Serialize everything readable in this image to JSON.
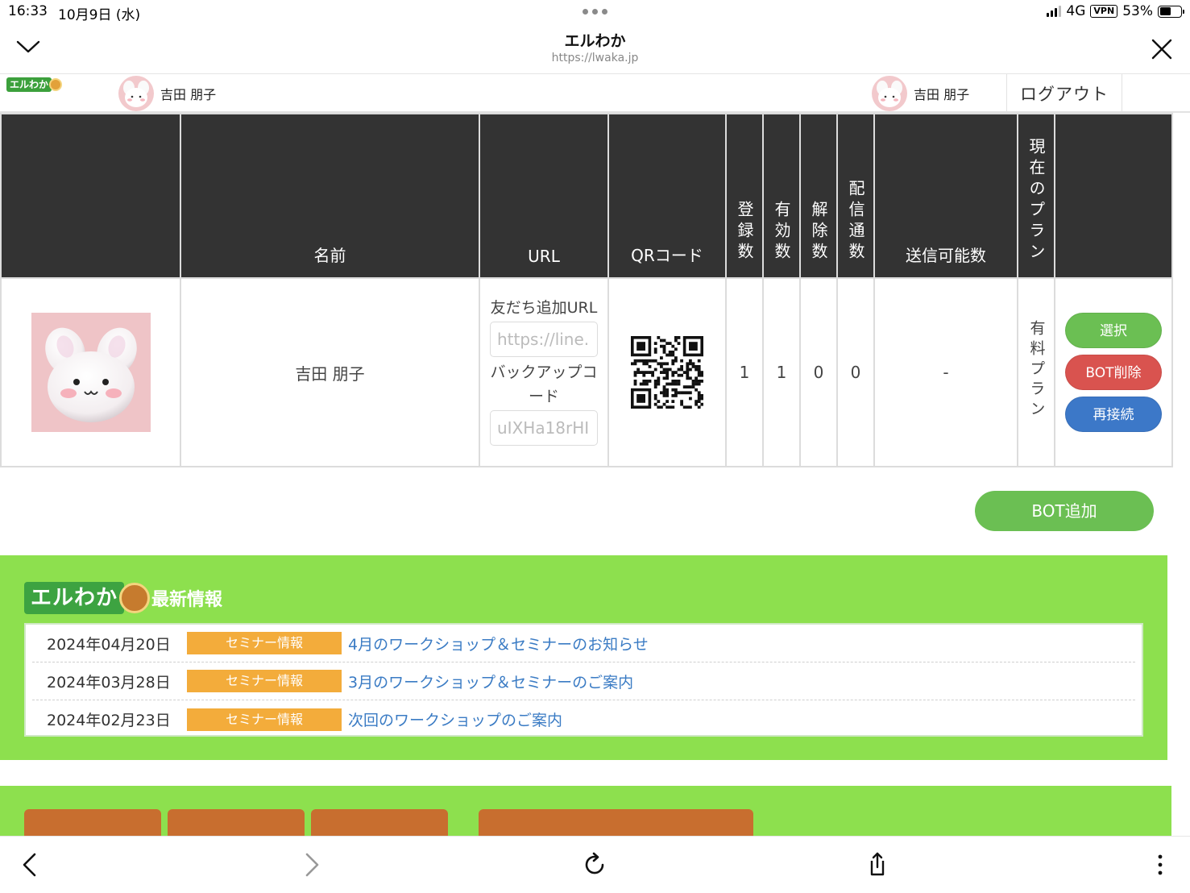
{
  "status_bar": {
    "time": "16:33",
    "date": "10月9日 (水)",
    "network": "4G",
    "vpn": "VPN",
    "battery": "53%",
    "battery_level": 0.53
  },
  "browser": {
    "title": "エルわか",
    "url": "https://lwaka.jp"
  },
  "app_nav": {
    "logo_text": "エルわか",
    "user_name": "吉田 朋子",
    "account_name": "吉田 朋子",
    "logout_label": "ログアウト"
  },
  "table": {
    "headers": {
      "name": "名前",
      "url": "URL",
      "qr": "QRコード",
      "registered": "登録数",
      "valid": "有効数",
      "cancelled": "解除数",
      "deliveries": "配信通数",
      "sendable": "送信可能数",
      "plan": "現在のプラン"
    },
    "row": {
      "name": "吉田 朋子",
      "friend_url_label": "友だち追加URL",
      "friend_url_value": "https://line.",
      "backup_label": "バックアップコード",
      "backup_value": "uIXHa18rHI",
      "registered": "1",
      "valid": "1",
      "cancelled": "0",
      "deliveries": "0",
      "sendable": "-",
      "plan": "有料プラン",
      "buttons": {
        "select": "選択",
        "delete": "BOT削除",
        "reconnect": "再接続"
      }
    }
  },
  "bot_add_label": "BOT追加",
  "news": {
    "logo_text": "エルわか",
    "heading": "最新情報",
    "items": [
      {
        "date": "2024年04月20日",
        "category": "セミナー情報",
        "title": "4月のワークショップ＆セミナーのお知らせ"
      },
      {
        "date": "2024年03月28日",
        "category": "セミナー情報",
        "title": "3月のワークショップ＆セミナーのご案内"
      },
      {
        "date": "2024年02月23日",
        "category": "セミナー情報",
        "title": "次回のワークショップのご案内"
      }
    ]
  },
  "colors": {
    "header_dark": "#333333",
    "green_section": "#8de04e",
    "button_green": "#6bbf53",
    "button_red": "#d9534f",
    "button_blue": "#3c78c8",
    "category_orange": "#f3ac3b",
    "link_blue": "#3a7bc4",
    "tab_brown": "#c86e2f"
  },
  "icons": {
    "collapse": "chevron-down-icon",
    "close": "close-icon",
    "back": "back-arrow-icon",
    "forward": "forward-arrow-icon",
    "reload": "reload-icon",
    "share": "share-icon",
    "more": "more-vertical-icon"
  }
}
